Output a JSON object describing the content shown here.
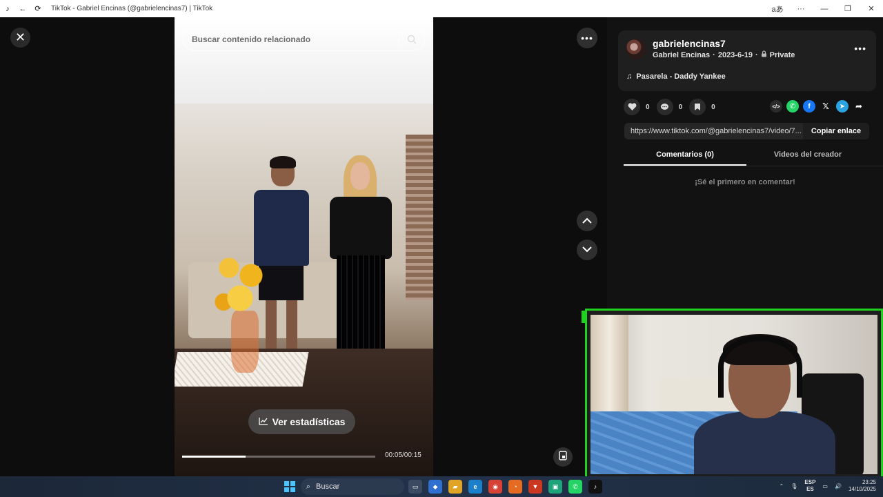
{
  "window": {
    "title": "TikTok - Gabriel Encinas (@gabrielencinas7) | TikTok",
    "read_aloud_label": "aあ",
    "more_label": "···",
    "minimize_label": "—",
    "maximize_label": "❐",
    "close_label": "✕"
  },
  "viewer": {
    "close_label": "✕",
    "search": {
      "placeholder": "Buscar contenido relacionado",
      "value": ""
    },
    "stats_button": "Ver estadísticas",
    "timecode": "00:05/00:15",
    "progress": 0.33,
    "more_label": "•••"
  },
  "post": {
    "username": "gabrielencinas7",
    "display_name": "Gabriel Encinas",
    "date": "2023-6-19",
    "separator": "·",
    "privacy": "Private",
    "music": "Pasarela - Daddy Yankee",
    "more_label": "•••",
    "likes": "0",
    "comments": "0",
    "saves": "0",
    "link": "https://www.tiktok.com/@gabrielencinas7/video/7...",
    "copy_link": "Copiar enlace"
  },
  "tabs": [
    {
      "label": "Comentarios (0)",
      "active": true
    },
    {
      "label": "Videos del creador",
      "active": false
    }
  ],
  "comments_empty": "¡Sé el primero en comentar!",
  "share_icons": [
    "embed-icon",
    "whatsapp-icon",
    "facebook-icon",
    "x-icon",
    "telegram-icon",
    "share-arrow-icon"
  ],
  "colors": {
    "accent_green": "#1fd21f",
    "whatsapp": "#25d366",
    "facebook": "#1877f2",
    "telegram": "#2aa3e0"
  },
  "taskbar": {
    "search_label": "Buscar",
    "lang_top": "ESP",
    "lang_bottom": "ES",
    "time": "23:25",
    "date": "14/10/2025"
  }
}
